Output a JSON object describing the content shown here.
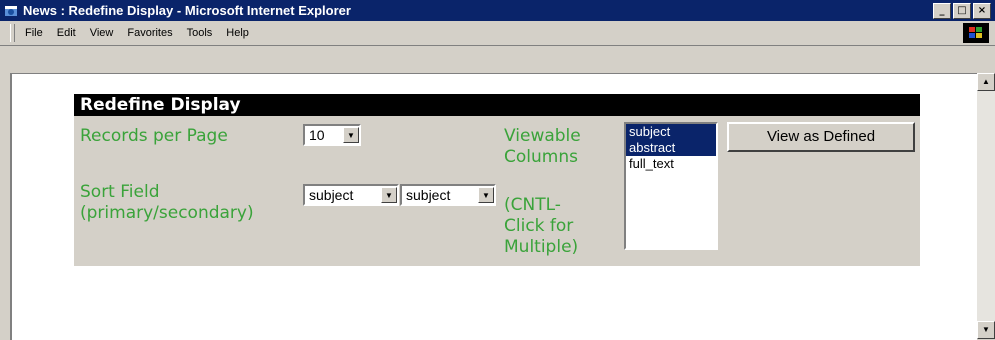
{
  "window": {
    "title": "News : Redefine Display - Microsoft Internet Explorer",
    "controls": [
      "_",
      "□",
      "×"
    ]
  },
  "menu": [
    "File",
    "Edit",
    "View",
    "Favorites",
    "Tools",
    "Help"
  ],
  "form": {
    "header": "Redefine Display",
    "records_label": "Records per Page",
    "records_value": "10",
    "sort_label_line1": "Sort Field",
    "sort_label_line2": "(primary/secondary)",
    "sort_primary_value": "subject",
    "sort_secondary_value": "subject",
    "viewable_label_line1": "Viewable",
    "viewable_label_line2": "Columns",
    "hint_line1": "(CNTL-",
    "hint_line2": "Click for",
    "hint_line3": "Multiple)",
    "columns_options": [
      {
        "label": "subject",
        "selected": true
      },
      {
        "label": "abstract",
        "selected": true
      },
      {
        "label": "full_text",
        "selected": false
      }
    ],
    "view_button": "View as Defined"
  },
  "colors": {
    "label_green": "#3aa33a",
    "selection_blue": "#0a246a",
    "panel_gray": "#d4d0c8"
  }
}
